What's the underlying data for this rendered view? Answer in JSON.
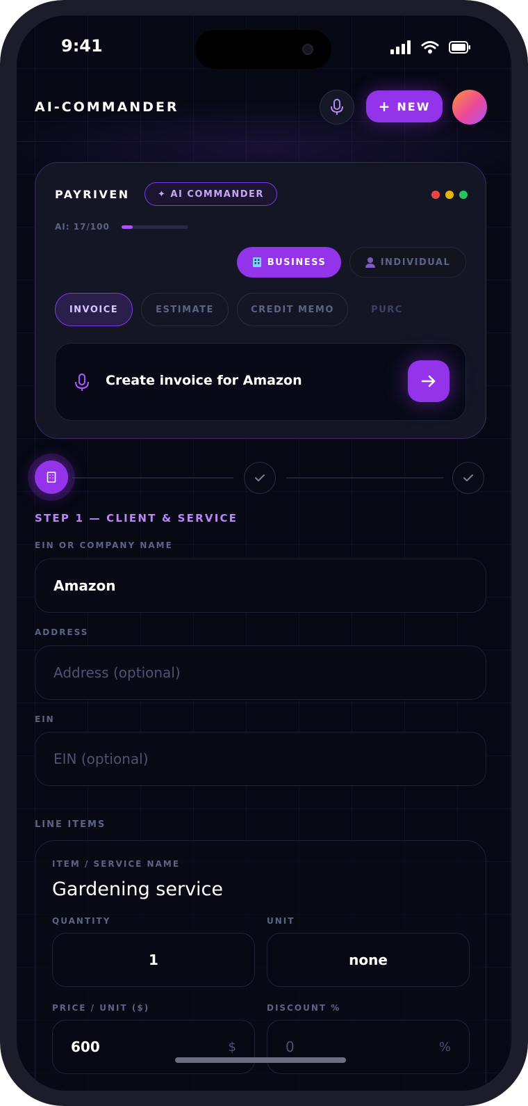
{
  "status": {
    "time": "9:41"
  },
  "header": {
    "brand": "AI-COMMANDER",
    "new_label": "NEW"
  },
  "commander": {
    "title": "PAYRIVEN",
    "badge": "✦ AI COMMANDER",
    "usage_label": "AI: 17/100",
    "usage_fraction": 0.17,
    "party_types": [
      {
        "label": "BUSINESS",
        "icon": "building-icon",
        "active": true
      },
      {
        "label": "INDIVIDUAL",
        "icon": "person-icon",
        "active": false
      }
    ],
    "doc_tabs": [
      "INVOICE",
      "ESTIMATE",
      "CREDIT MEMO",
      "PURC"
    ],
    "prompt": "Create invoice for Amazon"
  },
  "step": {
    "heading": "STEP 1 — CLIENT & SERVICE"
  },
  "form": {
    "company_label": "EIN OR COMPANY NAME",
    "company_value": "Amazon",
    "address_label": "ADDRESS",
    "address_placeholder": "Address (optional)",
    "ein_label": "EIN",
    "ein_placeholder": "EIN (optional)"
  },
  "line_items": {
    "section_label": "LINE ITEMS",
    "item_label": "ITEM / SERVICE NAME",
    "item_name": "Gardening service",
    "quantity_label": "QUANTITY",
    "quantity": "1",
    "unit_label": "UNIT",
    "unit": "none",
    "price_label": "PRICE / UNIT ($)",
    "price": "600",
    "price_suffix": "$",
    "discount_label": "DISCOUNT %",
    "discount": "0",
    "discount_suffix": "%"
  },
  "colors": {
    "accent": "#9333ea",
    "accent_light": "#c084fc",
    "background": "#060814",
    "window_dots": [
      "#ef4444",
      "#eab308",
      "#22c55e"
    ]
  }
}
